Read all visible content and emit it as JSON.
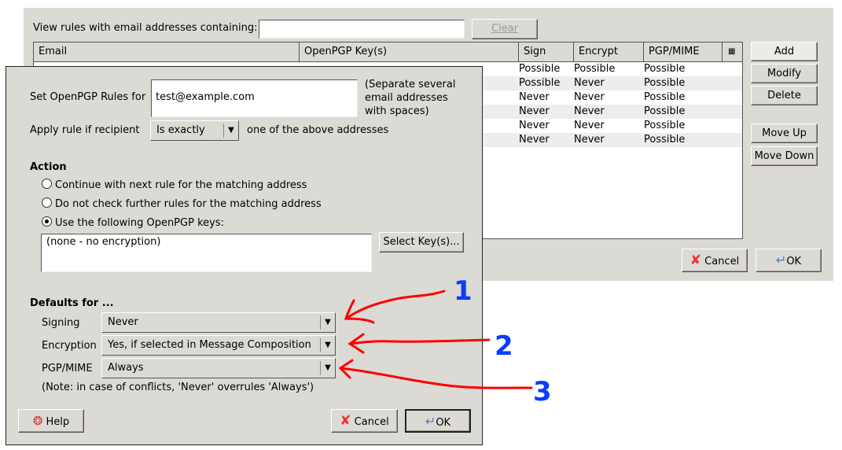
{
  "main_window": {
    "filter_label": "View rules with email addresses containing:",
    "filter_value": "",
    "clear_label": "Clear",
    "columns": [
      "Email",
      "OpenPGP Key(s)",
      "Sign",
      "Encrypt",
      "PGP/MIME"
    ],
    "rows": [
      {
        "sign": "Possible",
        "encrypt": "Possible",
        "pgpmime": "Possible"
      },
      {
        "sign": "Possible",
        "encrypt": "Never",
        "pgpmime": "Possible"
      },
      {
        "sign": "Never",
        "encrypt": "Never",
        "pgpmime": "Possible"
      },
      {
        "sign": "Never",
        "encrypt": "Never",
        "pgpmime": "Possible"
      },
      {
        "sign": "Never",
        "encrypt": "Never",
        "pgpmime": "Possible"
      },
      {
        "sign": "Never",
        "encrypt": "Never",
        "pgpmime": "Possible"
      }
    ],
    "buttons": {
      "add": "Add",
      "modify": "Modify",
      "delete": "Delete",
      "move_up": "Move Up",
      "move_down": "Move Down",
      "cancel": "Cancel",
      "ok": "OK"
    }
  },
  "rule_dialog": {
    "set_rules_label": "Set OpenPGP Rules for",
    "email_value": "test@example.com",
    "hint": [
      "(Separate several",
      "email addresses",
      "with spaces)"
    ],
    "apply_label": "Apply rule if recipient",
    "apply_select": "Is exactly",
    "apply_suffix": "one of the above addresses",
    "action_heading": "Action",
    "radios": [
      {
        "label": "Continue with next rule for the matching address",
        "checked": false
      },
      {
        "label": "Do not check further rules for the matching address",
        "checked": false
      },
      {
        "label": "Use the following OpenPGP keys:",
        "checked": true
      }
    ],
    "keys_value": "(none - no encryption)",
    "select_keys_label": "Select Key(s)...",
    "defaults_heading": "Defaults for ...",
    "signing_label": "Signing",
    "signing_value": "Never",
    "encryption_label": "Encryption",
    "encryption_value": "Yes, if selected in Message Composition",
    "pgpmime_label": "PGP/MIME",
    "pgpmime_value": "Always",
    "note": "(Note: in case of conflicts, 'Never' overrules 'Always')",
    "help_label": "Help",
    "cancel_label": "Cancel",
    "ok_label": "OK"
  },
  "annotations": {
    "labels": [
      "1",
      "2",
      "3"
    ],
    "arrow_color": "#ff0000",
    "number_color": "#0a3cff"
  }
}
